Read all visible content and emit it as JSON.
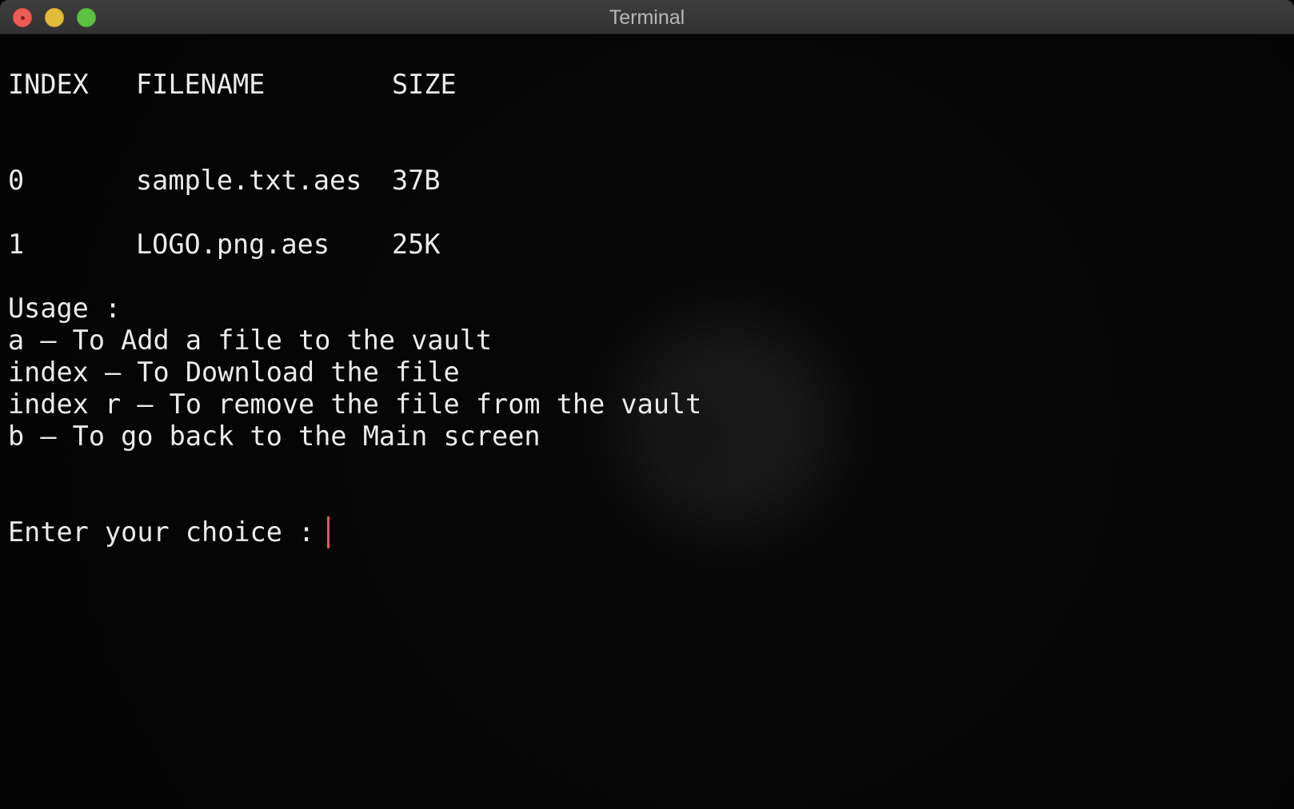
{
  "window": {
    "title": "Terminal"
  },
  "table": {
    "headers": {
      "index": "INDEX",
      "filename": "FILENAME",
      "size": "SIZE"
    },
    "rows": [
      {
        "index": "0",
        "filename": "sample.txt.aes",
        "size": "37B"
      },
      {
        "index": "1",
        "filename": "LOGO.png.aes",
        "size": "25K"
      }
    ]
  },
  "usage": {
    "heading": "Usage :",
    "lines": [
      "a – To Add a file to the vault",
      "index – To Download the file",
      "index r – To remove the file from the vault",
      "b – To go back to the Main screen"
    ]
  },
  "prompt": {
    "text": "Enter your choice : ",
    "value": ""
  },
  "colors": {
    "close": "#ed5d56",
    "minimize": "#e2bb3b",
    "maximize": "#5fc143",
    "cursor": "#e15a5a",
    "text": "#ebebeb",
    "background": "#050505"
  }
}
